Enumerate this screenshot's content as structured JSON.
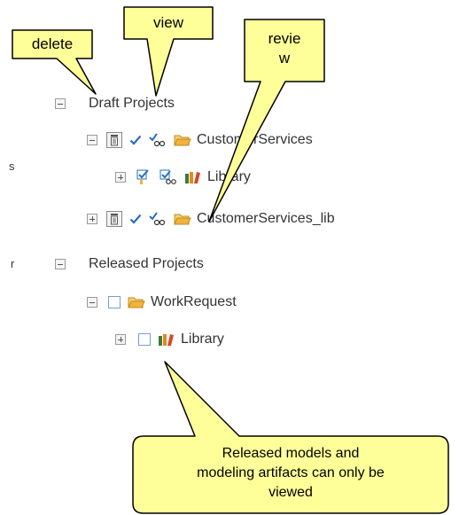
{
  "callouts": {
    "delete": "delete",
    "view": "view",
    "review_line1": "revie",
    "review_line2": "w",
    "released_line1": "Released models and",
    "released_line2": "modeling artifacts can only be",
    "released_line3": "viewed"
  },
  "left_edge_fragments": [
    "s",
    "r"
  ],
  "tree": {
    "draft_group": "Draft Projects",
    "draft_items": [
      {
        "label": "CustomerServices"
      },
      {
        "label": "Library"
      },
      {
        "label": "CustomerServices_lib"
      }
    ],
    "released_group": "Released Projects",
    "released_items": [
      {
        "label": "WorkRequest"
      },
      {
        "label": "Library"
      }
    ]
  },
  "colors": {
    "callout_fill": "#ffff99",
    "callout_stroke": "#000000",
    "folder": "#f2b33d",
    "checkmark": "#2a6ebd"
  }
}
